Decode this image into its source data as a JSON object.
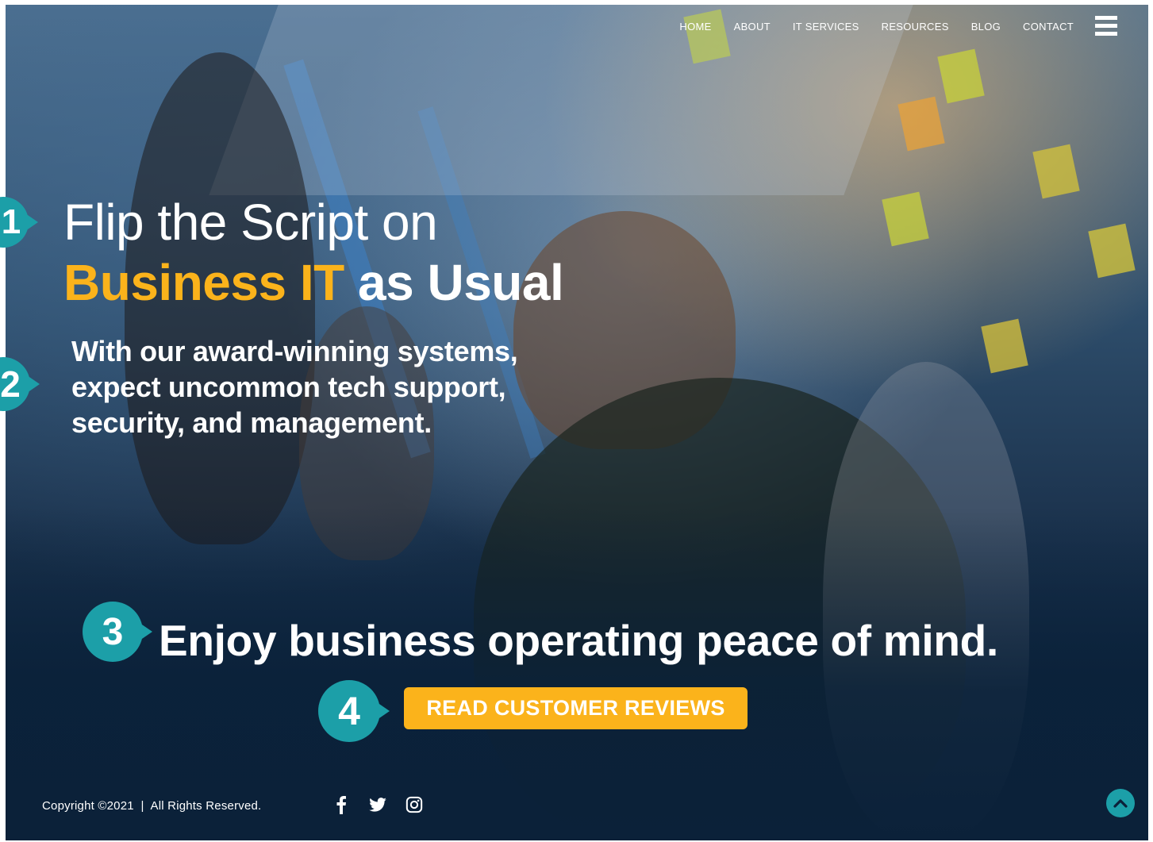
{
  "nav": {
    "items": [
      {
        "label": "HOME"
      },
      {
        "label": "ABOUT"
      },
      {
        "label": "IT SERVICES"
      },
      {
        "label": "RESOURCES"
      },
      {
        "label": "BLOG"
      },
      {
        "label": "CONTACT"
      }
    ],
    "menu_icon": "hamburger-icon"
  },
  "hero": {
    "headline_line1": "Flip the Script on",
    "headline_accent": "Business IT",
    "headline_rest": " as Usual",
    "subtext": "With our award-winning systems, expect uncommon tech support, security, and management.",
    "tagline": "Enjoy business operating peace of mind.",
    "cta_label": "READ CUSTOMER REVIEWS"
  },
  "markers": [
    {
      "number": "1"
    },
    {
      "number": "2"
    },
    {
      "number": "3"
    },
    {
      "number": "4"
    }
  ],
  "footer": {
    "copyright": "Copyright ©2021  |  All Rights Reserved.",
    "social": [
      "facebook-icon",
      "twitter-icon",
      "instagram-icon"
    ],
    "back_to_top_icon": "chevron-up-icon"
  },
  "colors": {
    "accent": "#fbb31b",
    "marker": "#1c9fa8",
    "dark_navy": "#0b2139",
    "text": "#ffffff"
  }
}
